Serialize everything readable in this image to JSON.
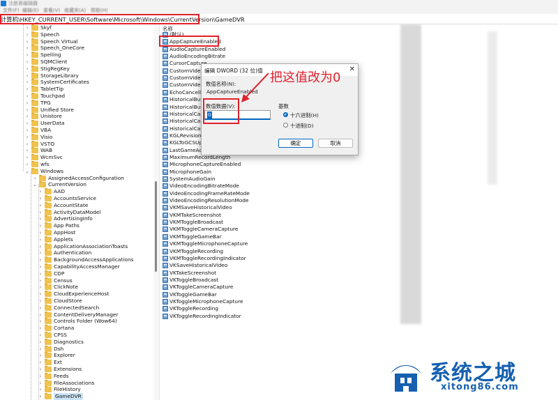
{
  "window": {
    "title": "注册表编辑器"
  },
  "menu": [
    "文件(F)",
    "编辑(E)",
    "查看(V)",
    "收藏夹(A)",
    "帮助(H)"
  ],
  "address": "计算机\\HKEY_CURRENT_USER\\Software\\Microsoft\\Windows\\CurrentVersion\\GameDVR",
  "tree": {
    "level1": [
      "Skyf",
      "Speech",
      "Speech Virtual",
      "Speech_OneCore",
      "Spelling",
      "SQMClient",
      "StigRegKey",
      "StorageLibrary",
      "SystemCertificates",
      "TabletTip",
      "Touchpad",
      "TPG",
      "Unified Store",
      "Unistore",
      "UserData",
      "VBA",
      "Visio",
      "VSTO",
      "WAB",
      "WcmSvc",
      "wfs",
      "Windows"
    ],
    "level2": [
      "AssignedAccessConfiguration",
      "CurrentVersion"
    ],
    "level3": [
      "AAD",
      "AccountsService",
      "AccountState",
      "ActivityDataModel",
      "AdvertisingInfo",
      "App Paths",
      "AppHost",
      "Applets",
      "ApplicationAssociationToasts",
      "Authentication",
      "BackgroundAccessApplications",
      "CapabilityAccessManager",
      "CDP",
      "Census",
      "ClickNote",
      "CloudExperienceHost",
      "CloudStore",
      "ConnectedSearch",
      "ContentDeliveryManager",
      "Controls Folder (Wow64)",
      "Cortana",
      "CPSS",
      "Diagnostics",
      "Dsh",
      "Explorer",
      "Ext",
      "Extensions",
      "Feeds",
      "FileAssociations",
      "FileHistory",
      "GameDVR"
    ]
  },
  "values": {
    "column_name": "名称",
    "items": [
      "(默认)",
      "AppCaptureEnabled",
      "AudioCaptureEnabled",
      "AudioEncodingBitrate",
      "CursorCaptureEnabled",
      "CustomVideoEncodingBitrate",
      "CustomVideoEncodingHeight",
      "CustomVideoEncodingWidth",
      "EchoCancellationEnabled",
      "HistoricalBufferLength",
      "HistoricalBufferLengthUnit",
      "HistoricalCaptureEnabled",
      "HistoricalCaptureOnBatteryAllowed",
      "HistoricalCaptureOnWirelessDisplayAllowed",
      "KGLRevision",
      "KGLToGCSUpdatedRevision",
      "LastGameActivated",
      "MaximumRecordLength",
      "MicrophoneCaptureEnabled",
      "MicrophoneGain",
      "SystemAudioGain",
      "VideoEncodingBitrateMode",
      "VideoEncodingFrameRateMode",
      "VideoEncodingResolutionMode",
      "VKMSaveHistoricalVideo",
      "VKMTakeScreenshot",
      "VKMToggleBroadcast",
      "VKMToggleCameraCapture",
      "VKMToggleGameBar",
      "VKMToggleMicrophoneCapture",
      "VKMToggleRecording",
      "VKMToggleRecordingIndicator",
      "VKSaveHistoricalVideo",
      "VKTakeScreenshot",
      "VKToggleBroadcast",
      "VKToggleCameraCapture",
      "VKToggleGameBar",
      "VKToggleMicrophoneCapture",
      "VKToggleRecording",
      "VKToggleRecordingIndicator"
    ],
    "truncated_display": {
      "4": "CursorCapture",
      "5": "CustomVideoE",
      "6": "CustomVideoE",
      "7": "CustomVideoE",
      "8": "EchoCancellati",
      "9": "HistoricalBuffe",
      "10": "HistoricalBuffe",
      "11": "HistoricalCapt",
      "12": "HistoricalCapt",
      "13": "HistoricalCapt",
      "15": "KGLToGCSUpd",
      "16": "LastGameActiv"
    }
  },
  "dialog": {
    "title": "编辑 DWORD (32 位)值",
    "close": "✕",
    "name_label": "数值名称(N):",
    "name_value": "AppCaptureEnabled",
    "data_label": "数值数据(V):",
    "data_value": "0",
    "base_label": "基数",
    "base_options": [
      {
        "label": "十六进制(H)",
        "checked": true
      },
      {
        "label": "十进制(D)",
        "checked": false
      }
    ],
    "ok": "确定",
    "cancel": "取消"
  },
  "annotation": "把这值改为0",
  "watermark": {
    "name": "系统之城",
    "url": "xitong86.com"
  },
  "colors": {
    "highlight_box": "#e0212b",
    "folder": "#f0c24e",
    "accent": "#0067c0",
    "brand": "#1560b0"
  }
}
